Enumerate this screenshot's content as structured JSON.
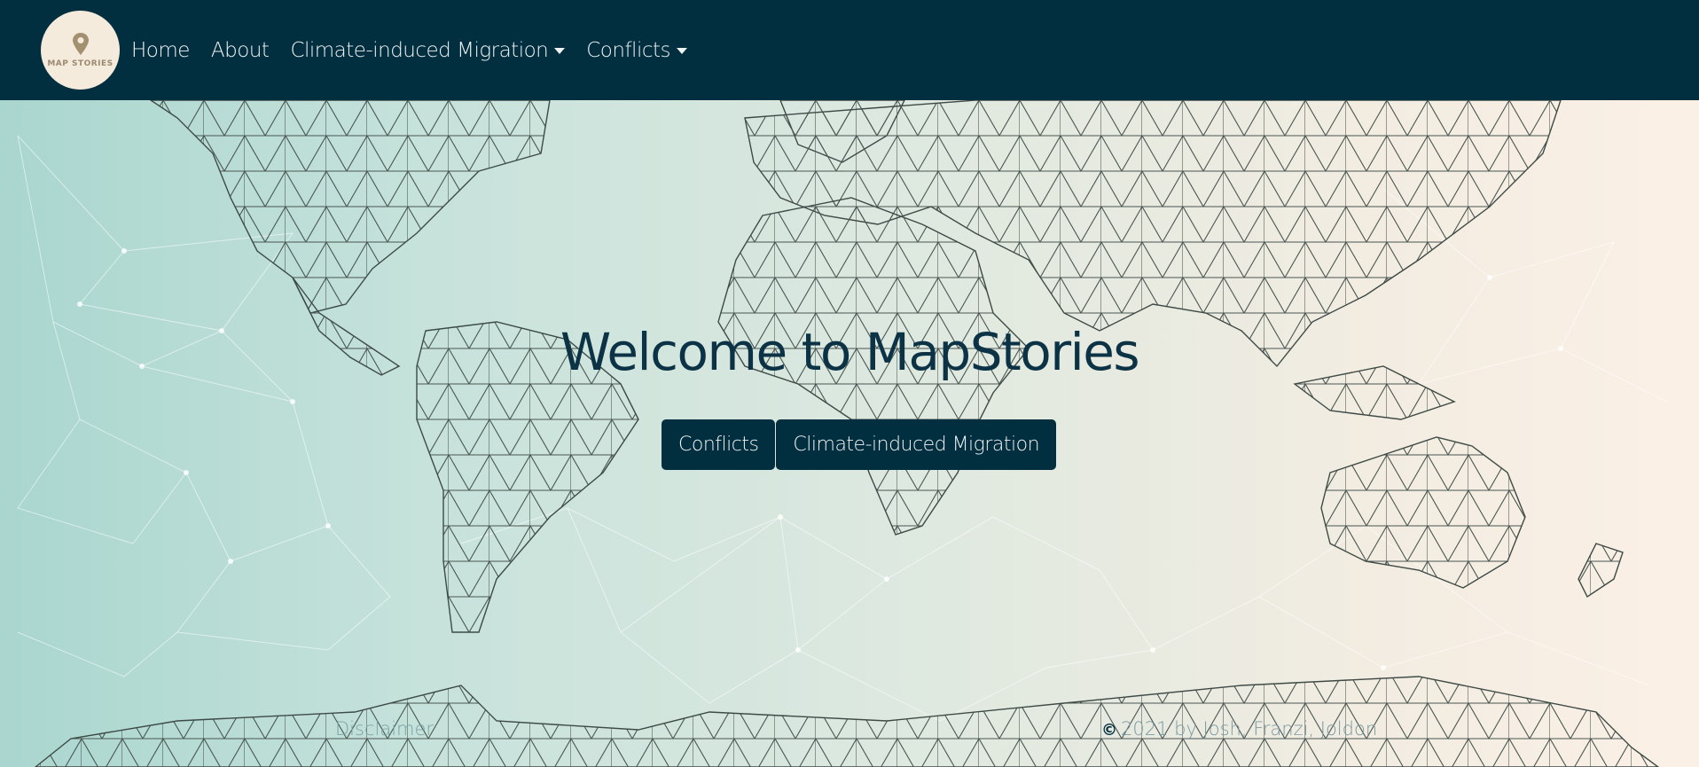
{
  "navbar": {
    "logo_text": "MAP STORIES",
    "items": [
      {
        "label": "Home"
      },
      {
        "label": "About"
      },
      {
        "label": "Climate-induced Migration",
        "dropdown": true
      },
      {
        "label": "Conflicts",
        "dropdown": true
      }
    ]
  },
  "hero": {
    "title": "Welcome to MapStories",
    "buttons": [
      {
        "label": "Conflicts"
      },
      {
        "label": "Climate-induced Migration"
      }
    ]
  },
  "footer": {
    "disclaimer": "Disclaimer",
    "copyright_symbol": "©",
    "copyright_text": "2021 by Josh, Franzi, Joldon"
  },
  "colors": {
    "navbar_bg": "#022f40",
    "nav_text": "#eef3f3",
    "title_color": "#0b3345",
    "button_bg": "#022f40",
    "gradient_left": "#a9d6cf",
    "gradient_right": "#fbf0e6"
  },
  "icons": {
    "logo_pin": "map-pin-icon",
    "dropdown": "caret-down-icon"
  }
}
